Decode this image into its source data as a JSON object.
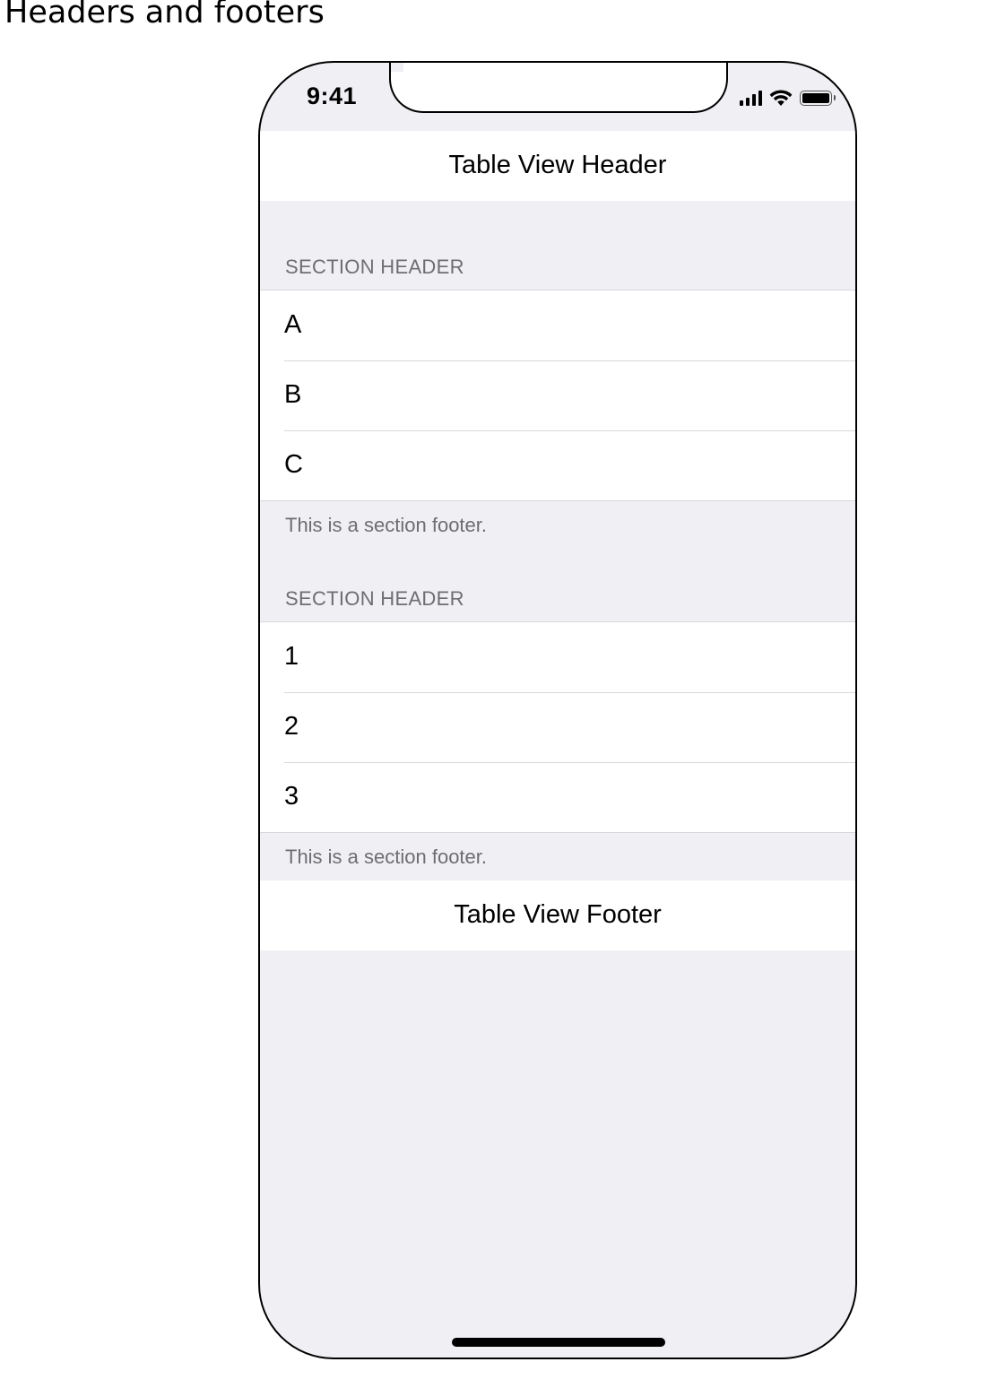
{
  "page": {
    "title": "Headers and footers"
  },
  "status_bar": {
    "time": "9:41",
    "icons": [
      "cellular-signal-icon",
      "wifi-icon",
      "battery-icon"
    ]
  },
  "table": {
    "header": "Table View Header",
    "sections": [
      {
        "header": "SECTION HEADER",
        "rows": [
          "A",
          "B",
          "C"
        ],
        "footer": "This is a section footer."
      },
      {
        "header": "SECTION HEADER",
        "rows": [
          "1",
          "2",
          "3"
        ],
        "footer": "This is a section footer."
      }
    ],
    "footer": "Table View Footer"
  },
  "colors": {
    "grouped_background": "#efeff4",
    "cell_background": "#ffffff",
    "secondary_text": "#6d6d72",
    "separator": "#d8d8dc"
  }
}
